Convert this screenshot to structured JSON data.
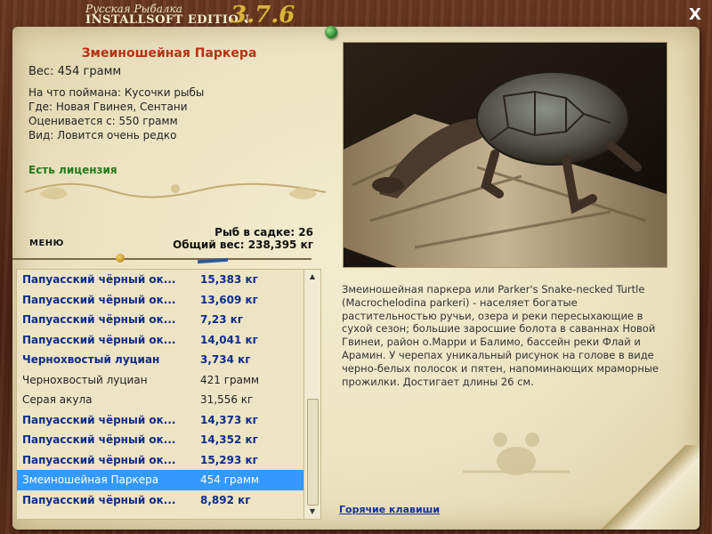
{
  "title": {
    "line1": "Русская Рыбалка",
    "line2": "INSTALLSOFT EDITION",
    "version": "3.7.6",
    "close_label": "X"
  },
  "fish": {
    "name": "Змеиношейная Паркера",
    "weight": "Вес: 454 грамм",
    "caught_on": "На что поймана: Кусочки рыбы",
    "location": "Где: Новая Гвинея, Сентани",
    "valued_from": "Оценивается с: 550 грамм",
    "rarity": "Вид: Ловится очень редко",
    "license": "Есть лицензия"
  },
  "menu_label": "МЕНЮ",
  "stats": {
    "fish_in_keepnet": "Рыб в садке: 26",
    "total_weight": "Общий вес: 238,395 кг"
  },
  "catch_list": [
    {
      "name": "Папуасский чёрный ок...",
      "weight": "15,383 кг",
      "bold": true
    },
    {
      "name": "Папуасский чёрный ок...",
      "weight": "13,609 кг",
      "bold": true
    },
    {
      "name": "Папуасский чёрный ок...",
      "weight": "7,23 кг",
      "bold": true
    },
    {
      "name": "Папуасский чёрный ок...",
      "weight": "14,041 кг",
      "bold": true
    },
    {
      "name": "Чернохвостый луциан",
      "weight": "3,734 кг",
      "bold": true
    },
    {
      "name": "Чернохвостый луциан",
      "weight": "421 грамм",
      "bold": false
    },
    {
      "name": "Серая акула",
      "weight": "31,556 кг",
      "bold": false
    },
    {
      "name": "Папуасский чёрный ок...",
      "weight": "14,373 кг",
      "bold": true
    },
    {
      "name": "Папуасский чёрный ок...",
      "weight": "14,352 кг",
      "bold": true
    },
    {
      "name": "Папуасский чёрный ок...",
      "weight": "15,293 кг",
      "bold": true
    },
    {
      "name": "Змеиношейная Паркера",
      "weight": "454 грамм",
      "bold": false,
      "selected": true
    },
    {
      "name": "Папуасский чёрный ок...",
      "weight": "8,892 кг",
      "bold": true
    }
  ],
  "description": "Змеиношейная паркера или Parker's Snake-necked Turtle (Macrochelodina parkeri) - населяет богатые растительностью ручьи, озера и реки пересыхающие в сухой сезон; большие заросшие болота в саваннах Новой Гвинеи, район о.Марри и Балимо, бассейн реки Флай и Арамин. У черепах уникальный рисунок на голове в виде черно-белых полосок и пятен, напоминающих мраморные прожилки. Достигает длины 26 см.",
  "hotkeys_label": "Горячие клавиши",
  "colors": {
    "fish_name": "#b83214",
    "license": "#237a1c",
    "list_bold": "#0f2d8a",
    "selection": "#3399ff",
    "link": "#1530a0"
  }
}
